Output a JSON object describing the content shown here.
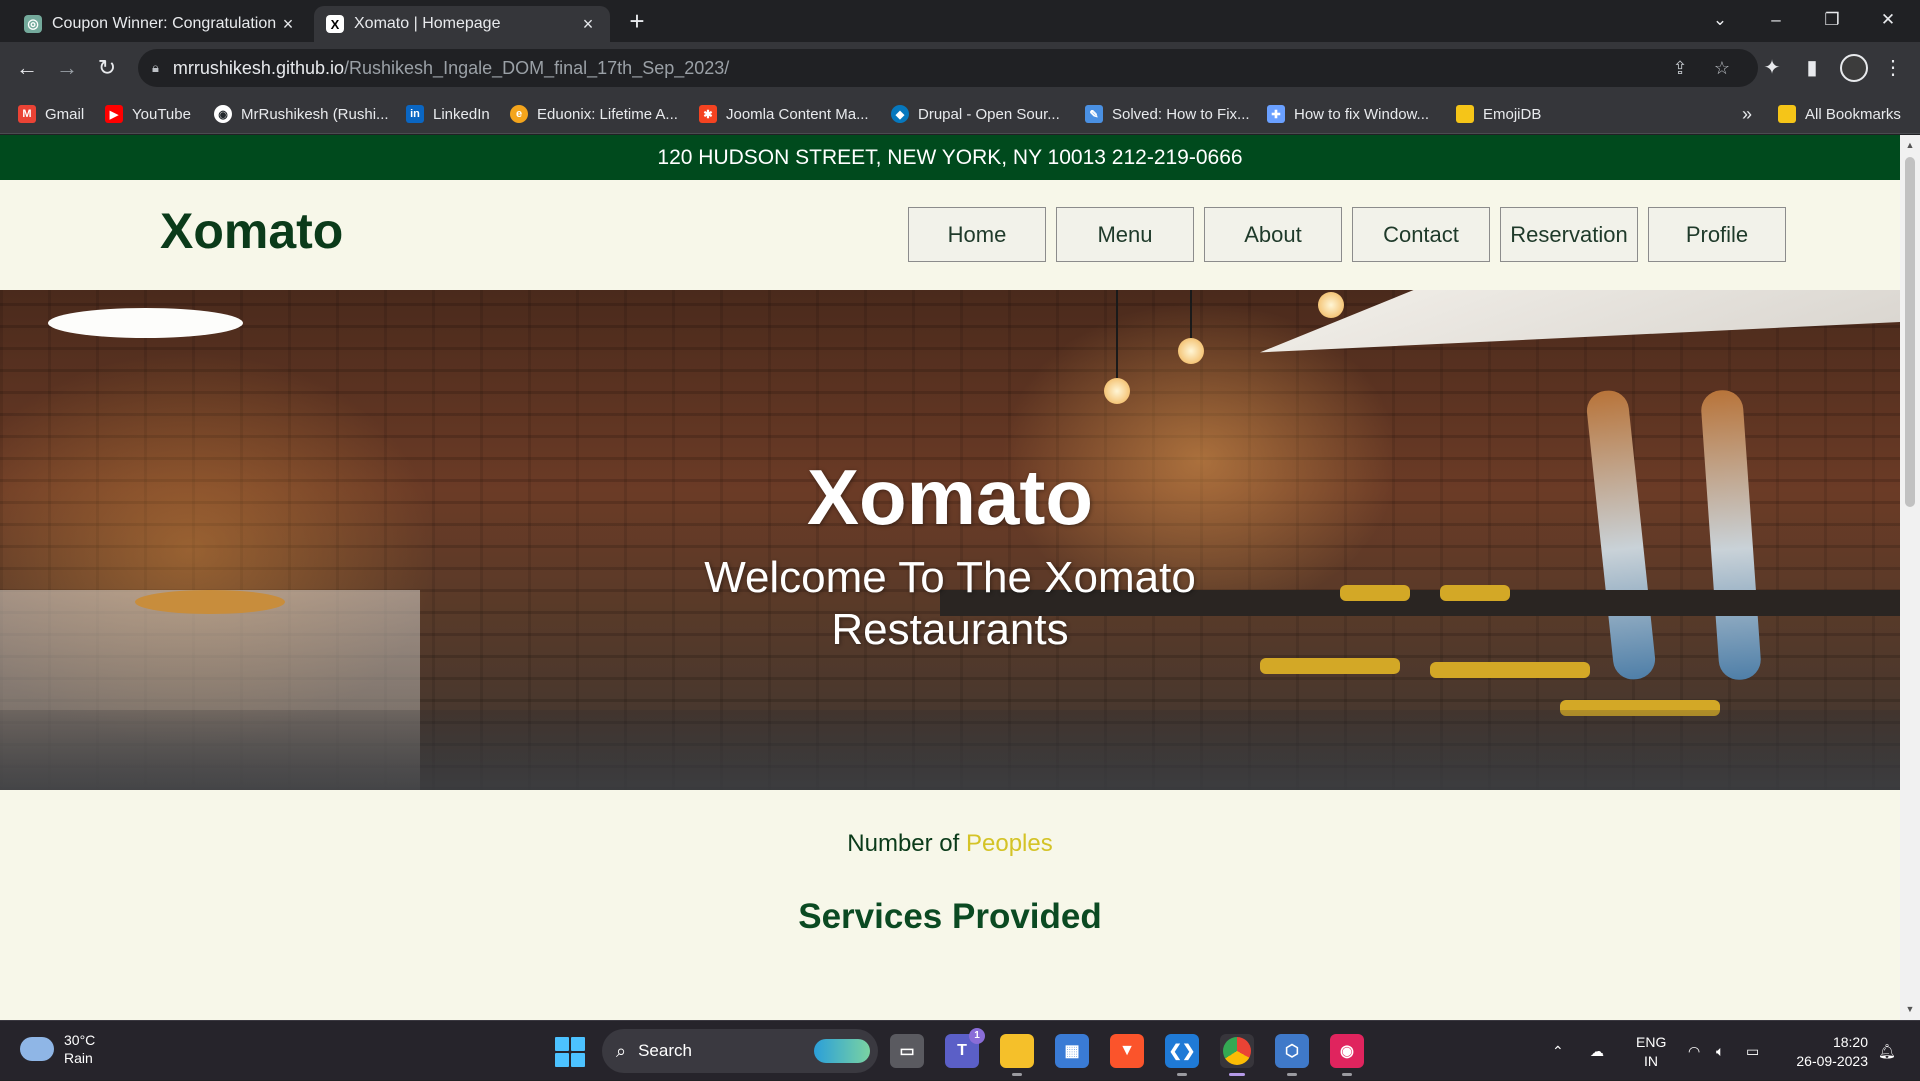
{
  "browser": {
    "tabs": [
      {
        "title": "Coupon Winner: Congratulation",
        "favicon": "chatgpt-icon",
        "active": false
      },
      {
        "title": "Xomato | Homepage",
        "favicon": "x-icon",
        "active": true
      }
    ],
    "url_host": "mrrushikesh.github.io",
    "url_path": "/Rushikesh_Ingale_DOM_final_17th_Sep_2023/",
    "bookmarks": [
      {
        "label": "Gmail",
        "icon": "gmail-icon",
        "color": "#ea4335"
      },
      {
        "label": "YouTube",
        "icon": "youtube-icon",
        "color": "#ff0000"
      },
      {
        "label": "MrRushikesh (Rushi...",
        "icon": "github-icon",
        "color": "#ffffff"
      },
      {
        "label": "LinkedIn",
        "icon": "linkedin-icon",
        "color": "#0a66c2"
      },
      {
        "label": "Eduonix: Lifetime A...",
        "icon": "eduonix-icon",
        "color": "#f4a51c"
      },
      {
        "label": "Joomla Content Ma...",
        "icon": "joomla-icon",
        "color": "#f44321"
      },
      {
        "label": "Drupal - Open Sour...",
        "icon": "drupal-icon",
        "color": "#0678be"
      },
      {
        "label": "Solved: How to Fix...",
        "icon": "solved-icon",
        "color": "#4a90e2"
      },
      {
        "label": "How to fix Window...",
        "icon": "windows-fix-icon",
        "color": "#6aa0ff"
      },
      {
        "label": "EmojiDB",
        "icon": "folder-icon",
        "color": "#f5c518"
      }
    ],
    "all_bookmarks": "All Bookmarks",
    "more_bookmarks": "»"
  },
  "page": {
    "address_bar": "120 HUDSON STREET, NEW YORK, NY 10013 212-219-0666",
    "logo": "Xomato",
    "nav": [
      "Home",
      "Menu",
      "About",
      "Contact",
      "Reservation",
      "Profile"
    ],
    "hero_title": "Xomato",
    "hero_subtitle": "Welcome To The Xomato Restaurants",
    "count_prefix": "Number of",
    "count_highlight": "Peoples",
    "services_heading": "Services Provided",
    "colors": {
      "topbar": "#004a1d",
      "background": "#f7f7e9",
      "logo": "#0b3b1a",
      "highlight": "#d4c327"
    }
  },
  "taskbar": {
    "temperature": "30°C",
    "condition": "Rain",
    "search_label": "Search",
    "lang_top": "ENG",
    "lang_bottom": "IN",
    "time": "18:20",
    "date": "26-09-2023",
    "teams_badge": "1"
  }
}
